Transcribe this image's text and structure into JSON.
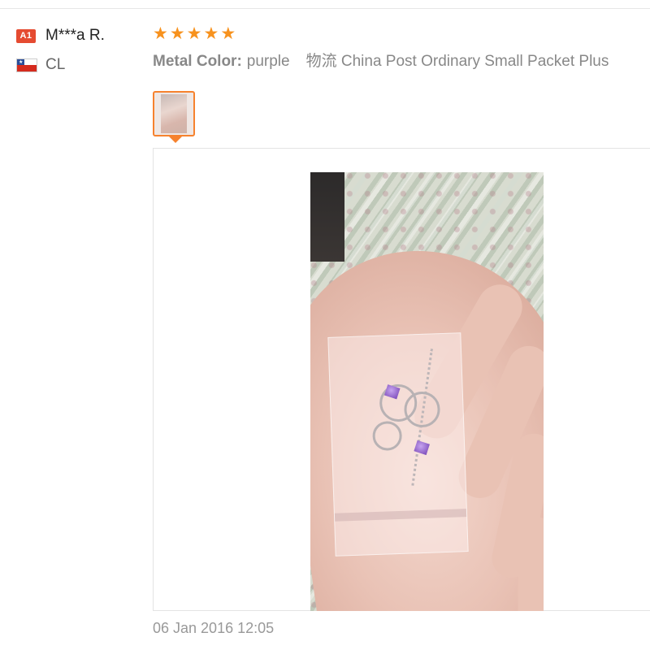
{
  "user": {
    "level_badge": "A1",
    "name": "M***a R.",
    "country": "CL",
    "flag_icon": "chile-flag-icon"
  },
  "review": {
    "rating": 5,
    "rating_max": 5,
    "star_color": "#f7921e",
    "attribute_label": "Metal Color:",
    "attribute_value": "purple",
    "logistics": "物流 China Post Ordinary Small Packet Plus",
    "thumbnail_count": 1,
    "selected_thumbnail_index": 0,
    "date": "06 Jan 2016 12:05"
  },
  "colors": {
    "accent": "#f6822e",
    "badge": "#e54b31"
  }
}
